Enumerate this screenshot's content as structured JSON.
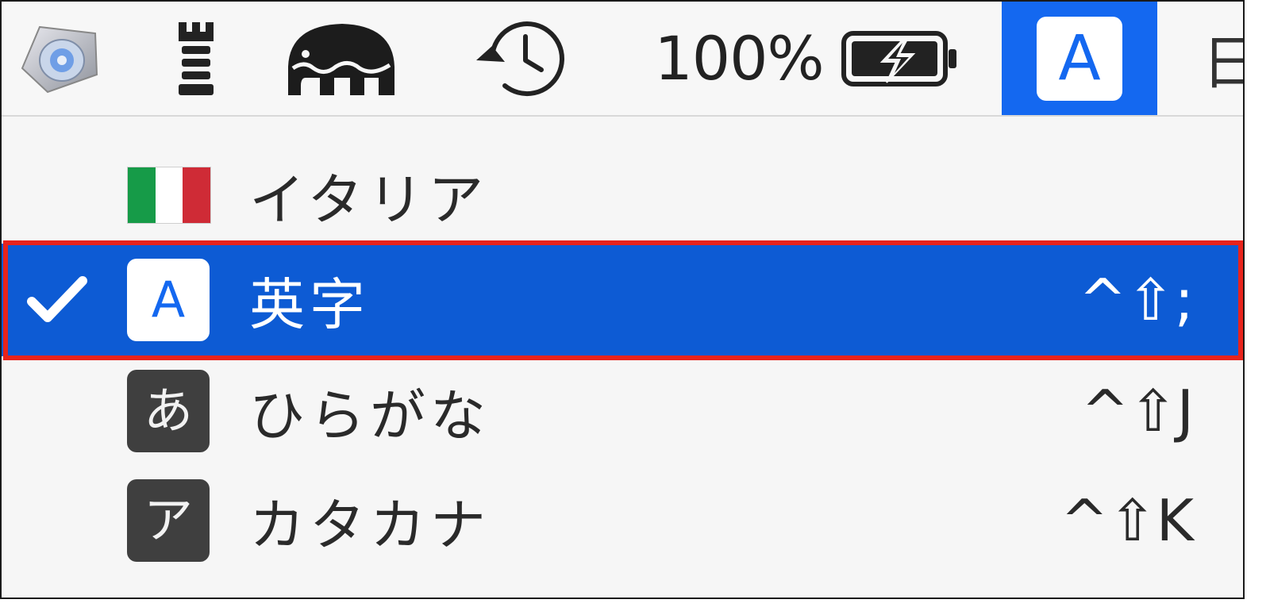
{
  "menubar": {
    "battery_percent": "100%",
    "input_source_badge": "A",
    "next_item_partial": "日",
    "icons": [
      "disk-utility-icon",
      "tower-icon",
      "elephant-icon",
      "time-machine-icon",
      "battery-charging-icon"
    ]
  },
  "menu": {
    "items": [
      {
        "label": "イタリア",
        "icon": "italy-flag-icon",
        "shortcut": "",
        "checked": false,
        "selected": false
      },
      {
        "label": "英字",
        "icon_text": "A",
        "shortcut": "^⇧;",
        "checked": true,
        "selected": true
      },
      {
        "label": "ひらがな",
        "icon_text": "あ",
        "shortcut": "^⇧J",
        "checked": false,
        "selected": false
      },
      {
        "label": "カタカナ",
        "icon_text": "ア",
        "shortcut": "^⇧K",
        "checked": false,
        "selected": false
      }
    ]
  },
  "colors": {
    "selection": "#0d5bd4",
    "menubar_active": "#1468f0",
    "annotation_box": "#e8231b",
    "flag_green": "#169b48",
    "flag_white": "#ffffff",
    "flag_red": "#cf2b36"
  }
}
